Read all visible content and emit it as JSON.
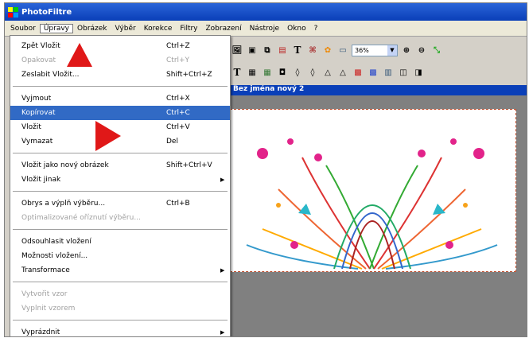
{
  "app": {
    "title": "PhotoFiltre"
  },
  "menubar": [
    {
      "label": "Soubor"
    },
    {
      "label": "Úpravy"
    },
    {
      "label": "Obrázek"
    },
    {
      "label": "Výběr"
    },
    {
      "label": "Korekce"
    },
    {
      "label": "Filtry"
    },
    {
      "label": "Zobrazení"
    },
    {
      "label": "Nástroje"
    },
    {
      "label": "Okno"
    },
    {
      "label": "?"
    }
  ],
  "toolbar": {
    "zoom": "36%",
    "text_tool": "T",
    "text_tool2": "T"
  },
  "document": {
    "title": "Bez jména nový 2"
  },
  "edit_menu": {
    "items": [
      {
        "label": "Zpět Vložit",
        "shortcut": "Ctrl+Z"
      },
      {
        "label": "Opakovat",
        "shortcut": "Ctrl+Y"
      },
      {
        "label": "Zeslabit Vložit...",
        "shortcut": "Shift+Ctrl+Z"
      },
      {
        "label": "Vyjmout",
        "shortcut": "Ctrl+X"
      },
      {
        "label": "Kopírovat",
        "shortcut": "Ctrl+C"
      },
      {
        "label": "Vložit",
        "shortcut": "Ctrl+V"
      },
      {
        "label": "Vymazat",
        "shortcut": "Del"
      },
      {
        "label": "Vložit jako nový obrázek",
        "shortcut": "Shift+Ctrl+V"
      },
      {
        "label": "Vložit jinak",
        "shortcut": ""
      },
      {
        "label": "Obrys a výplň výběru...",
        "shortcut": "Ctrl+B"
      },
      {
        "label": "Optimalizované oříznutí výběru...",
        "shortcut": ""
      },
      {
        "label": "Odsouhlasit vložení",
        "shortcut": ""
      },
      {
        "label": "Možnosti vložení...",
        "shortcut": ""
      },
      {
        "label": "Transformace",
        "shortcut": ""
      },
      {
        "label": "Vytvořit vzor",
        "shortcut": ""
      },
      {
        "label": "Vyplnit vzorem",
        "shortcut": ""
      },
      {
        "label": "Vyprázdnit",
        "shortcut": ""
      }
    ]
  },
  "colors": {
    "title_bar": "#0a3fb8",
    "highlight": "#316ac5",
    "annotation_arrow": "#e01818"
  }
}
